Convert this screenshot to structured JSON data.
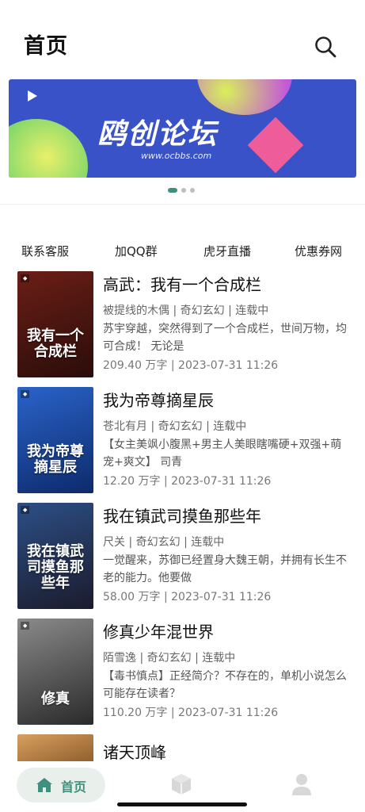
{
  "header": {
    "title": "首页",
    "search_icon": "search-icon"
  },
  "banner": {
    "logo_text": "鸥创论坛",
    "url_text": "www.ocbbs.com",
    "dots": 3,
    "active_dot": 0
  },
  "quick_links": [
    "联系客服",
    "加QQ群",
    "虎牙直播",
    "优惠券网"
  ],
  "books": [
    {
      "title": "高武：我有一个合成栏",
      "meta": "被提线的木偶 | 奇幻玄幻 | 连载中",
      "desc": "苏宇穿越，突然得到了一个合成栏，世间万物，均可合成！ 无论是",
      "stats": "209.40 万字 | 2023-07-31 11:26",
      "cover_text": "我有一个合成栏",
      "cover_colors": [
        "#6b1e16",
        "#2a0d0a"
      ]
    },
    {
      "title": "我为帝尊摘星辰",
      "meta": "苍北有月 | 奇幻玄幻 | 连载中",
      "desc": "【女主美飒小腹黑+男主人美眼瞎嘴硬+双强+萌宠+爽文】 司青",
      "stats": "12.20 万字 | 2023-07-31 11:26",
      "cover_text": "我为帝尊摘星辰",
      "cover_colors": [
        "#2a63c9",
        "#0d2a6b"
      ]
    },
    {
      "title": "我在镇武司摸鱼那些年",
      "meta": "尺关 | 奇幻玄幻 | 连载中",
      "desc": "一觉醒来，苏御已经置身大魏王朝，并拥有长生不老的能力。他要做",
      "stats": "58.00 万字 | 2023-07-31 11:26",
      "cover_text": "我在镇武司摸鱼那些年",
      "cover_colors": [
        "#2c4f86",
        "#1b1b2c"
      ]
    },
    {
      "title": "修真少年混世界",
      "meta": "陌雪逸 | 奇幻玄幻 | 连载中",
      "desc": "【毒书慎点】正经简介？不存在的，单机小说怎么可能存在读者？",
      "stats": "110.20 万字 | 2023-07-31 11:26",
      "cover_text": "修真",
      "cover_colors": [
        "#8a8a8a",
        "#2a2a2a"
      ]
    },
    {
      "title": "诸天顶峰",
      "cover_colors": [
        "#d8a060",
        "#8a5a2a"
      ]
    }
  ],
  "tabbar": {
    "home_label": "首页",
    "accent": "#3f8f7f"
  }
}
